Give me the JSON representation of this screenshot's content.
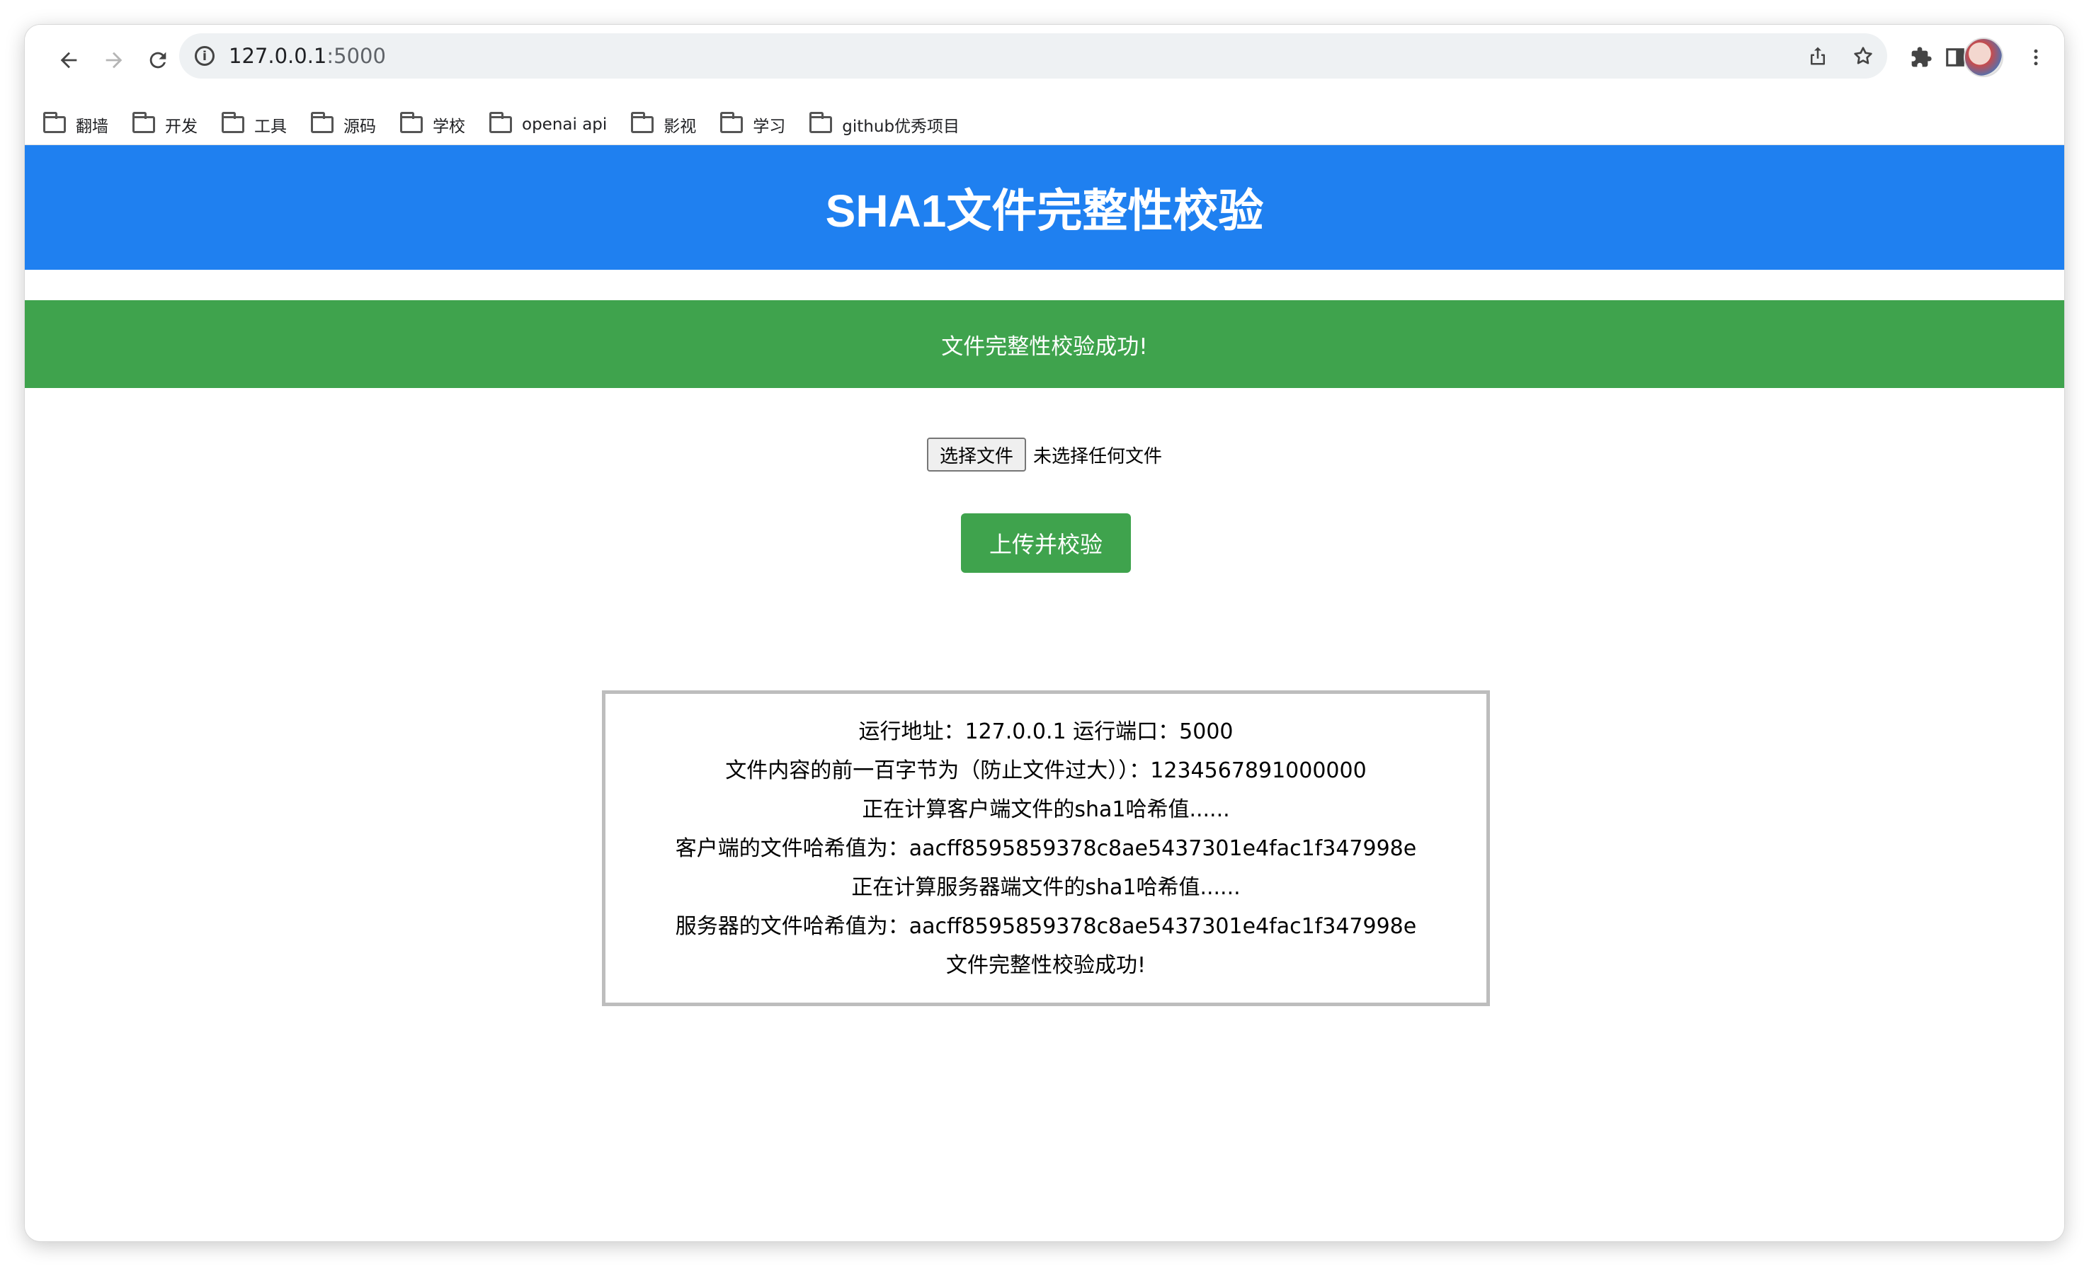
{
  "browser": {
    "url_host": "127.0.0.1",
    "url_port": ":5000",
    "bookmarks": [
      {
        "label": "翻墙"
      },
      {
        "label": "开发"
      },
      {
        "label": "工具"
      },
      {
        "label": "源码"
      },
      {
        "label": "学校"
      },
      {
        "label": "openai api"
      },
      {
        "label": "影视"
      },
      {
        "label": "学习"
      },
      {
        "label": "github优秀项目"
      }
    ]
  },
  "page": {
    "title": "SHA1文件完整性校验",
    "success_message": "文件完整性校验成功!",
    "file_input": {
      "button_label": "选择文件",
      "status": "未选择任何文件"
    },
    "upload_button": "上传并校验",
    "log_lines": [
      "运行地址：127.0.0.1 运行端口：5000",
      "文件内容的前一百字节为（防止文件过大））：1234567891000000",
      "正在计算客户端文件的sha1哈希值......",
      "客户端的文件哈希值为：aacff8595859378c8ae5437301e4fac1f347998e",
      "正在计算服务器端文件的sha1哈希值......",
      "服务器的文件哈希值为：aacff8595859378c8ae5437301e4fac1f347998e",
      "文件完整性校验成功!"
    ]
  },
  "colors": {
    "header_blue": "#1f80f0",
    "success_green": "#3fa34d",
    "log_border": "#bdbdbd"
  },
  "icons": {
    "back": "arrow-left-icon",
    "forward": "arrow-right-icon",
    "reload": "reload-icon",
    "site_info": "info-icon",
    "share": "share-icon",
    "bookmark_star": "star-icon",
    "extensions": "puzzle-icon",
    "side_panel": "side-panel-icon",
    "menu": "kebab-menu-icon"
  }
}
